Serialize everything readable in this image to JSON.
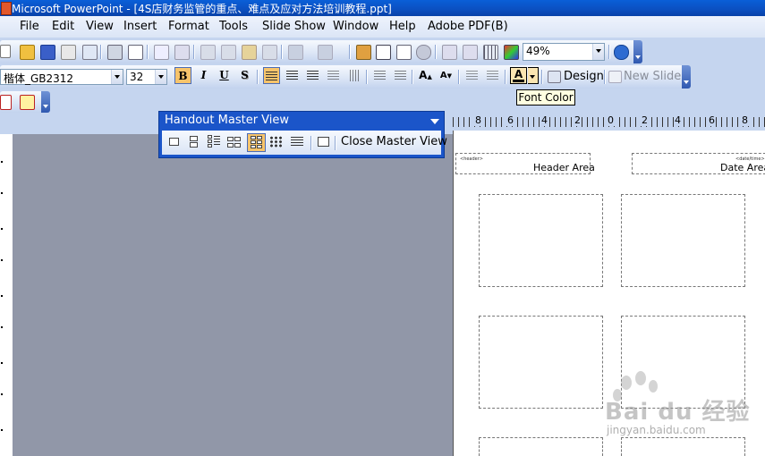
{
  "window": {
    "title": "Microsoft PowerPoint - [4S店财务监管的重点、难点及应对方法培训教程.ppt]"
  },
  "menu": [
    "File",
    "Edit",
    "View",
    "Insert",
    "Format",
    "Tools",
    "Slide Show",
    "Window",
    "Help",
    "Adobe PDF(B)"
  ],
  "standard_toolbar": {
    "zoom": "49%"
  },
  "formatting_toolbar": {
    "font": "楷体_GB2312",
    "size": "32",
    "bold": "B",
    "italic": "I",
    "underline": "U",
    "shadow": "S",
    "design_label": "Design",
    "new_slide_label": "New Slide",
    "font_color_glyph": "A"
  },
  "tooltip": "Font Color",
  "handout_toolbar": {
    "title": "Handout Master View",
    "close_label": "Close Master View"
  },
  "ruler": {
    "labels": [
      "8",
      "6",
      "4",
      "2",
      "0",
      "2",
      "4",
      "6",
      "8"
    ]
  },
  "page": {
    "header_small": "<header>",
    "header_area": "Header Area",
    "date_small": "<date/time>",
    "date_area": "Date Area"
  },
  "watermark": {
    "brand": "Bai du 经验",
    "url": "jingyan.baidu.com"
  },
  "colors": {
    "accent": "#1b55c9",
    "work_area": "#9197a8",
    "toolbar": "#c5d5ef",
    "font_color": "#000000"
  }
}
